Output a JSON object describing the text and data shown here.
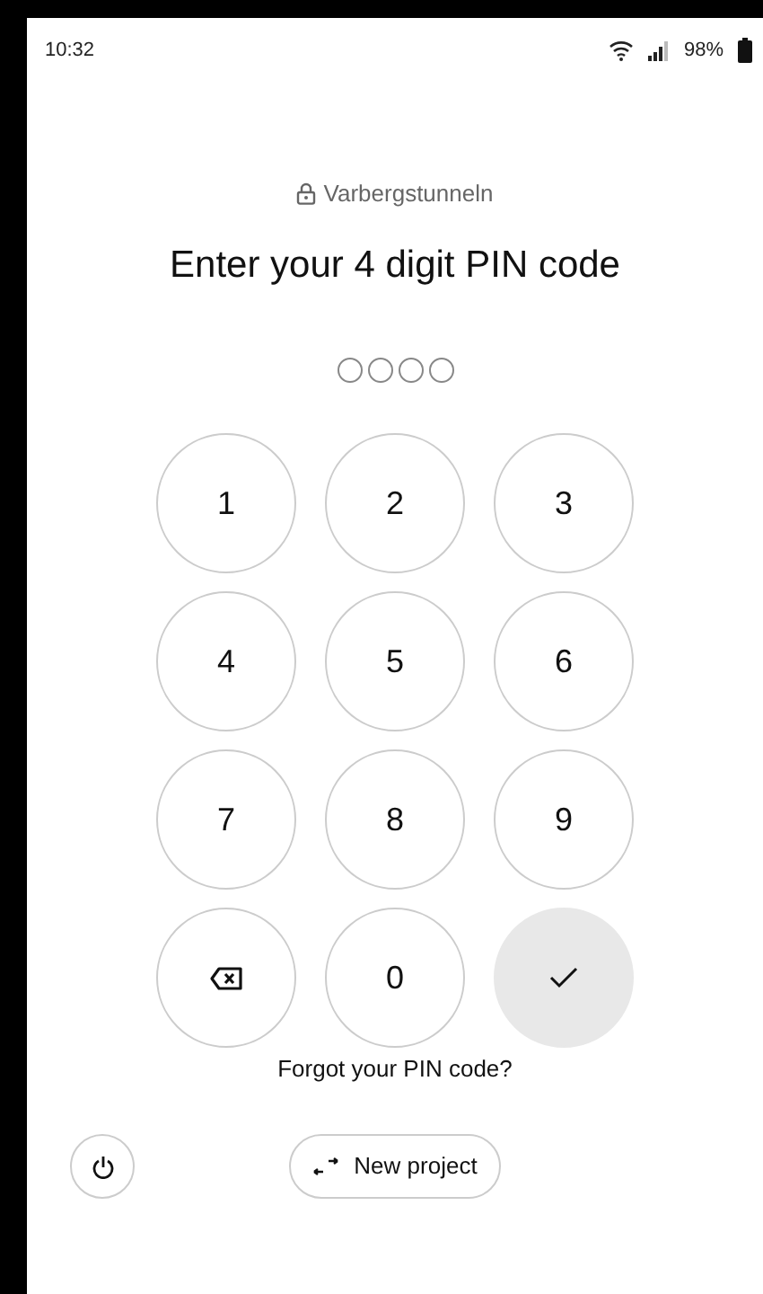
{
  "status_bar": {
    "time": "10:32",
    "battery": "98%"
  },
  "project": {
    "name": "Varbergstunneln"
  },
  "title": "Enter your 4 digit PIN code",
  "pin_dots": [
    {
      "filled": false
    },
    {
      "filled": false
    },
    {
      "filled": false
    },
    {
      "filled": false
    }
  ],
  "keypad": [
    {
      "kind": "digit",
      "label": "1"
    },
    {
      "kind": "digit",
      "label": "2"
    },
    {
      "kind": "digit",
      "label": "3"
    },
    {
      "kind": "digit",
      "label": "4"
    },
    {
      "kind": "digit",
      "label": "5"
    },
    {
      "kind": "digit",
      "label": "6"
    },
    {
      "kind": "digit",
      "label": "7"
    },
    {
      "kind": "digit",
      "label": "8"
    },
    {
      "kind": "digit",
      "label": "9"
    },
    {
      "kind": "backspace"
    },
    {
      "kind": "digit",
      "label": "0"
    },
    {
      "kind": "confirm"
    }
  ],
  "forgot_link": "Forgot your PIN code?",
  "new_project_button": "New project"
}
